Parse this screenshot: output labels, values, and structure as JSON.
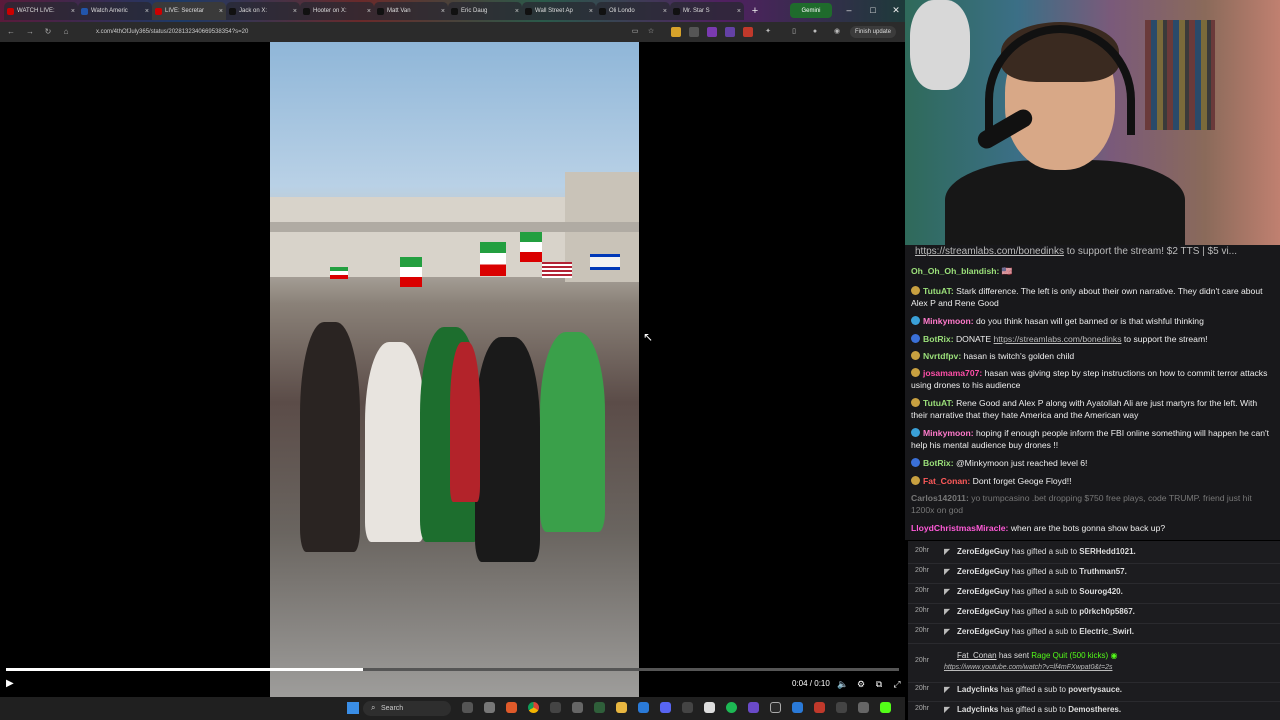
{
  "browser": {
    "tabs": [
      {
        "title": "WATCH LIVE:",
        "fav_color": "#cc0000"
      },
      {
        "title": "Watch Americ",
        "fav_color": "#2255aa"
      },
      {
        "title": "LIVE: Secretar",
        "fav_color": "#cc0000",
        "active": true
      },
      {
        "title": "Jack on X:",
        "fav_color": "#111111"
      },
      {
        "title": "Hooter on X:",
        "fav_color": "#111111"
      },
      {
        "title": "Matt Van",
        "fav_color": "#111111"
      },
      {
        "title": "Eric Daug",
        "fav_color": "#111111"
      },
      {
        "title": "Wall Street Ap",
        "fav_color": "#111111"
      },
      {
        "title": "Oli Londo",
        "fav_color": "#111111"
      },
      {
        "title": "Mr. Star S",
        "fav_color": "#111111"
      }
    ],
    "gemini_label": "Gemini",
    "url": "x.com/4thOfJuly365/status/2028132340669538354?s=20",
    "finish_update_label": "Finish update"
  },
  "video": {
    "progress_fraction": 0.4,
    "time": "0:04 / 0:10"
  },
  "chat": {
    "pinned_link": "https://streamlabs.com/bonedinks",
    "pinned_text": " to support the stream! $2 TTS | $5 vi...",
    "messages": [
      {
        "user": "Oh_Oh_Oh_blandish:",
        "color": "#9be07a",
        "text": " 🇺🇸",
        "badge": ""
      },
      {
        "user": "TutuAT:",
        "color": "#9be07a",
        "text": " Stark difference. The left is only about their own narrative. They didn't care about Alex P and Rene Good",
        "badge": "#c8a040"
      },
      {
        "user": "Minkymoon:",
        "color": "#ff7acb",
        "text": " do you think hasan will get banned or is that wishful thinking",
        "badge": "#3aa0d8"
      },
      {
        "user": "BotRix:",
        "color": "#9be07a",
        "text": " DONATE ",
        "link": "https://streamlabs.com/bonedinks",
        "tail": " to support the stream!",
        "badge": "#3a70d8"
      },
      {
        "user": "Nvrtdfpv:",
        "color": "#9be07a",
        "text": " hasan is twitch's golden child",
        "badge": "#c8a040"
      },
      {
        "user": "josamama707:",
        "color": "#ff4fa8",
        "text": " hasan was giving step by step instructions on how to commit terror attacks using drones to his audience",
        "badge": "#c8a040"
      },
      {
        "user": "TutuAT:",
        "color": "#9be07a",
        "text": " Rene Good and Alex P along with Ayatollah Ali are just martyrs for the left. With their narrative that they hate America and the American way",
        "badge": "#c8a040"
      },
      {
        "user": "Minkymoon:",
        "color": "#ff7acb",
        "text": " hoping if enough people inform the FBI online something will happen he can't help his mental audience buy drones !!",
        "badge": "#3aa0d8"
      },
      {
        "user": "BotRix:",
        "color": "#9be07a",
        "text": " @Minkymoon just reached level 6!",
        "badge": "#3a70d8"
      },
      {
        "user": "Fat_Conan:",
        "color": "#ff5a5a",
        "text": " Dont forget Geoge Floyd!!",
        "badge": "#c8a040"
      },
      {
        "user": "Carlos142011:",
        "color": "#777777",
        "text": " yo trumpcasino .bet dropping $750 free plays, code TRUMP. friend just hit 1200x on god",
        "badge": "",
        "dim": true
      },
      {
        "user": "LloydChristmasMiracle:",
        "color": "#ff5ad8",
        "text": " when are the bots gonna show back up?",
        "badge": ""
      }
    ]
  },
  "feed": {
    "rows": [
      {
        "age": "20hr",
        "gifter": "ZeroEdgeGuy",
        "mid": " has gifted a sub to ",
        "recipient": "SERHedd1021."
      },
      {
        "age": "20hr",
        "gifter": "ZeroEdgeGuy",
        "mid": " has gifted a sub to ",
        "recipient": "Truthman57."
      },
      {
        "age": "20hr",
        "gifter": "ZeroEdgeGuy",
        "mid": " has gifted a sub to ",
        "recipient": "Sourog420."
      },
      {
        "age": "20hr",
        "gifter": "ZeroEdgeGuy",
        "mid": " has gifted a sub to ",
        "recipient": "p0rkch0p5867."
      },
      {
        "age": "20hr",
        "gifter": "ZeroEdgeGuy",
        "mid": " has gifted a sub to ",
        "recipient": "Electric_Swirl."
      }
    ],
    "kick_row": {
      "age": "20hr",
      "user": "Fat_Conan",
      "mid": " has sent ",
      "item": "Rage Quit (500 kicks)",
      "link": "https://www.youtube.com/watch?v=lf4mFXwpat0&t=2s"
    },
    "rows2": [
      {
        "age": "20hr",
        "gifter": "Ladyclinks",
        "mid": " has gifted a sub to ",
        "recipient": "povertysauce."
      },
      {
        "age": "20hr",
        "gifter": "Ladyclinks",
        "mid": " has gifted a sub to ",
        "recipient": "Demostheres."
      }
    ]
  },
  "taskbar": {
    "search_placeholder": "Search"
  }
}
